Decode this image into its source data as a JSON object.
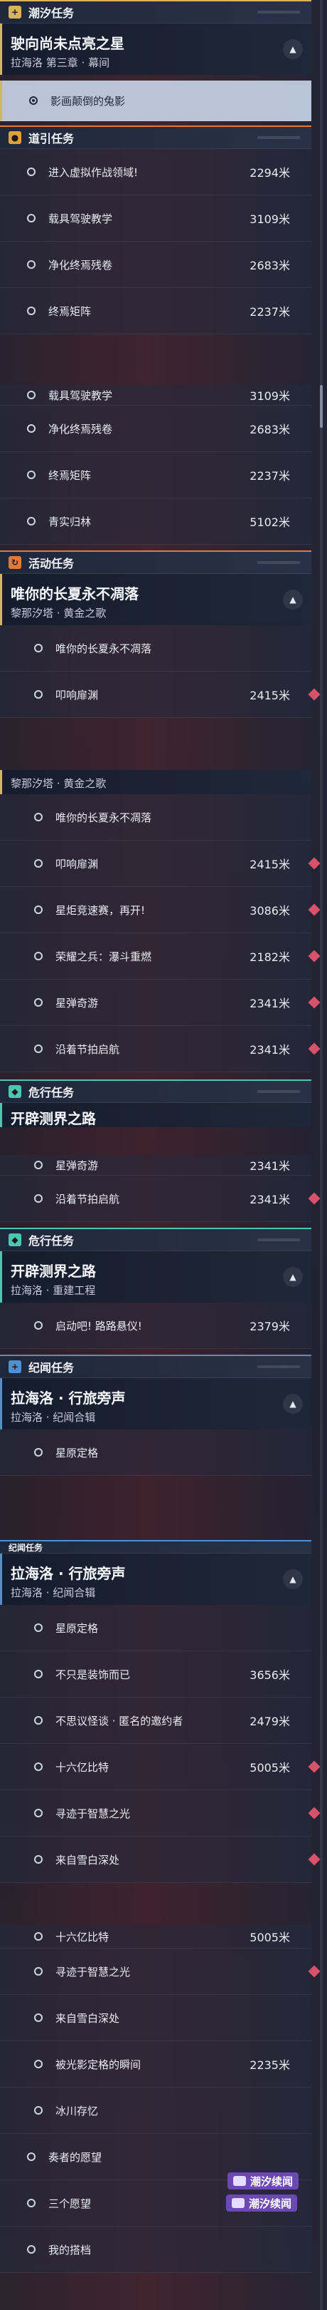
{
  "categories": {
    "chaoxi": "潮汐任务",
    "guide": "道引任务",
    "activity": "活动任务",
    "danger": "危行任务",
    "story": "纪闻任务"
  },
  "main_quest": {
    "title": "驶向尚未点亮之星",
    "subtitle": "拉海洛 第三章 · 幕间",
    "selected_step": "影画颠倒的兔影"
  },
  "guide_items": [
    {
      "label": "进入虚拟作战领域!",
      "dist": "2294米"
    },
    {
      "label": "载具驾驶教学",
      "dist": "3109米"
    },
    {
      "label": "净化终焉残卷",
      "dist": "2683米"
    },
    {
      "label": "终焉矩阵",
      "dist": "2237米"
    },
    {
      "label": "青实归林",
      "dist": "5102米"
    }
  ],
  "activity_quest": {
    "title": "唯你的长夏永不凋落",
    "subtitle": "黎那汐塔 · 黄金之歌"
  },
  "activity_items": [
    {
      "label": "唯你的长夏永不凋落",
      "dist": ""
    },
    {
      "label": "叩响扉渊",
      "dist": "2415米"
    },
    {
      "label": "星炬竞速赛，再开!",
      "dist": "3086米"
    },
    {
      "label": "荣耀之兵：瀑斗重燃",
      "dist": "2182米"
    },
    {
      "label": "星弹奇游",
      "dist": "2341米"
    },
    {
      "label": "沿着节拍启航",
      "dist": "2341米"
    }
  ],
  "danger_quest": {
    "title": "开辟测界之路",
    "subtitle": "拉海洛 · 重建工程"
  },
  "danger_items": [
    {
      "label": "启动吧! 路路悬仪!",
      "dist": "2379米"
    }
  ],
  "story_quest": {
    "title": "拉海洛 · 行旅旁声",
    "subtitle": "拉海洛 · 纪闻合辑"
  },
  "story_items": [
    {
      "label": "星原定格",
      "dist": ""
    },
    {
      "label": "不只是装饰而已",
      "dist": "3656米"
    },
    {
      "label": "不思议怪谈 · 匿名的邀约者",
      "dist": "2479米"
    },
    {
      "label": "十六亿比特",
      "dist": "5005米"
    },
    {
      "label": "寻迹于智慧之光",
      "dist": ""
    },
    {
      "label": "来自雪白深处",
      "dist": ""
    },
    {
      "label": "被光影定格的瞬间",
      "dist": "2235米"
    },
    {
      "label": "冰川存忆",
      "dist": ""
    },
    {
      "label": "奏者的愿望",
      "dist": ""
    },
    {
      "label": "三个愿望",
      "dist": ""
    },
    {
      "label": "我的搭档",
      "dist": ""
    }
  ],
  "tag_label": "潮汐续闻",
  "colors": {
    "gold": "#d9b35a",
    "orange": "#e07a3a",
    "teal": "#48c7b1",
    "blue": "#4f8fd4",
    "marker": "#d8526a"
  }
}
